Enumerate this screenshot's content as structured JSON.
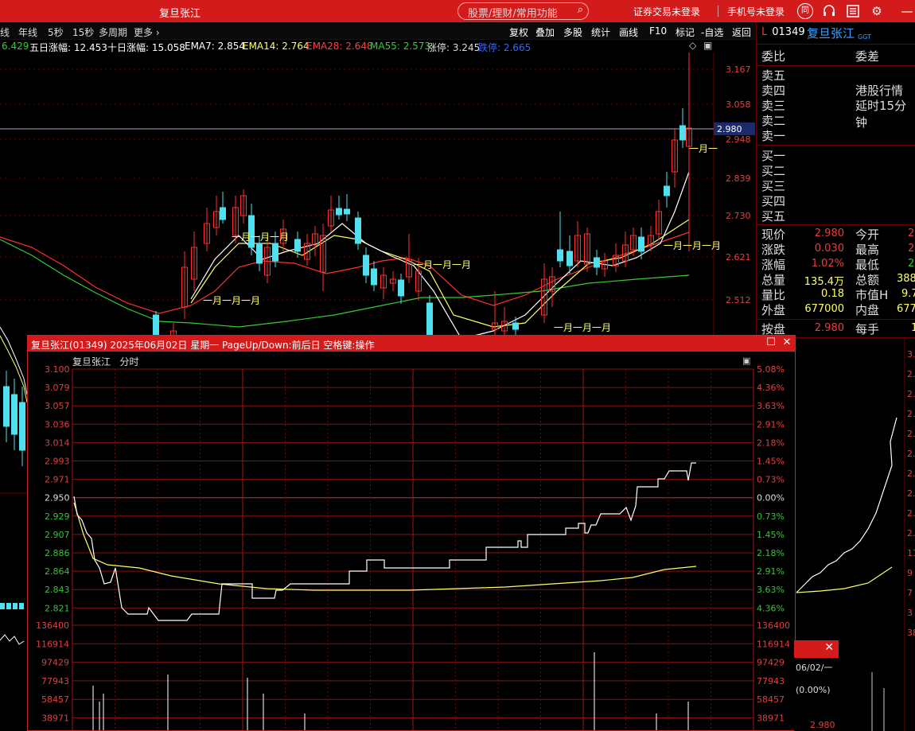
{
  "window": {
    "title": "复旦张江",
    "search_placeholder": "股票/理财/常用功能",
    "broker_login": "证券交易未登录",
    "phone_login": "手机号未登录",
    "icons": [
      "logo-icon",
      "headset-icon",
      "list-icon",
      "gear-icon",
      "minimize-icon"
    ]
  },
  "toolbar": {
    "left": [
      "线",
      "年线",
      "5秒",
      "15秒",
      "多周期",
      "更多"
    ],
    "right": [
      "复权",
      "叠加",
      "多股",
      "统计",
      "画线",
      "F10",
      "标记",
      "-自选",
      "返回"
    ]
  },
  "indicators": {
    "prefix": "6.429",
    "five_day": "五日涨幅: 12.453",
    "ten_day": "十日涨幅: 15.058",
    "ema7": "EMA7: 2.854",
    "ema14": "EMA14: 2.764",
    "ema28": "EMA28: 2.648",
    "ma55": "MA55: 2.573",
    "limit_up": "涨停: 3.245",
    "limit_down": "跌停: 2.665",
    "colors": {
      "ema7": "#ffffff",
      "ema14": "#ffff66",
      "ema28": "#ff4040",
      "ma55": "#33cc33",
      "limit_down": "#3366ff"
    }
  },
  "kline": {
    "price_ticks": [
      "3.167",
      "3.058",
      "2.948",
      "2.839",
      "2.730",
      "2.621",
      "2.512"
    ],
    "current_price_tag": "2.980",
    "annotations": [
      "一月一月一月",
      "一月一月一月",
      "一月一月一月",
      "一月一月一月",
      "一月一月一月",
      "一月一"
    ],
    "partial_right_ticks": [
      "3.",
      "2.",
      "2.",
      "2.",
      "2.",
      "2.",
      "2.",
      "2.",
      "2.",
      "2.",
      "11",
      "9",
      "7",
      "3",
      "38"
    ]
  },
  "quote": {
    "code": "01349",
    "market_flag": "L",
    "name": "复旦张江",
    "tag": "GGT",
    "wei_bi": "委比",
    "wei_cha": "委差",
    "sell_levels": [
      "卖五",
      "卖四",
      "卖三",
      "卖二",
      "卖一"
    ],
    "buy_levels": [
      "买一",
      "买二",
      "买三",
      "买四",
      "买五"
    ],
    "notice_line1": "港股行情",
    "notice_line2": "延时15分钟",
    "stats": [
      {
        "label": "现价",
        "value": "2.980",
        "label2": "今开",
        "value2": "2"
      },
      {
        "label": "涨跌",
        "value": "0.030",
        "label2": "最高",
        "value2": "2"
      },
      {
        "label": "涨幅",
        "value": "1.02%",
        "label2": "最低",
        "value2": "2"
      },
      {
        "label": "总量",
        "value": "135.4万",
        "label2": "总额",
        "value2": "388"
      },
      {
        "label": "量比",
        "value": "0.18",
        "label2": "市值H",
        "value2": "9.7"
      },
      {
        "label": "外盘",
        "value": "677000",
        "label2": "内盘",
        "value2": "677"
      }
    ],
    "an_pan_label": "按盘",
    "an_pan_value": "2.980",
    "mei_shou_label": "每手",
    "mei_shou_value": "1"
  },
  "popup": {
    "title": "复旦张江(01349) 2025年06月02日 星期一 PageUp/Down:前后日 空格键:操作",
    "subhead_name": "复旦张江",
    "subhead_mode": "分时",
    "price_ticks": [
      "3.100",
      "3.079",
      "3.057",
      "3.036",
      "3.014",
      "2.993",
      "2.971",
      "2.950",
      "2.929",
      "2.907",
      "2.886",
      "2.864",
      "2.843",
      "2.821"
    ],
    "pct_ticks": [
      "5.08%",
      "4.36%",
      "3.63%",
      "2.91%",
      "2.18%",
      "1.45%",
      "0.73%",
      "0.00%",
      "0.73%",
      "1.45%",
      "2.18%",
      "2.91%",
      "3.63%",
      "4.36%"
    ],
    "volume_ticks": [
      "136400",
      "116914",
      "97429",
      "77943",
      "58457",
      "38971"
    ],
    "mini_date": "06/02/一",
    "mini_pct": "(0.00%)",
    "mini_price": "2.980"
  }
}
